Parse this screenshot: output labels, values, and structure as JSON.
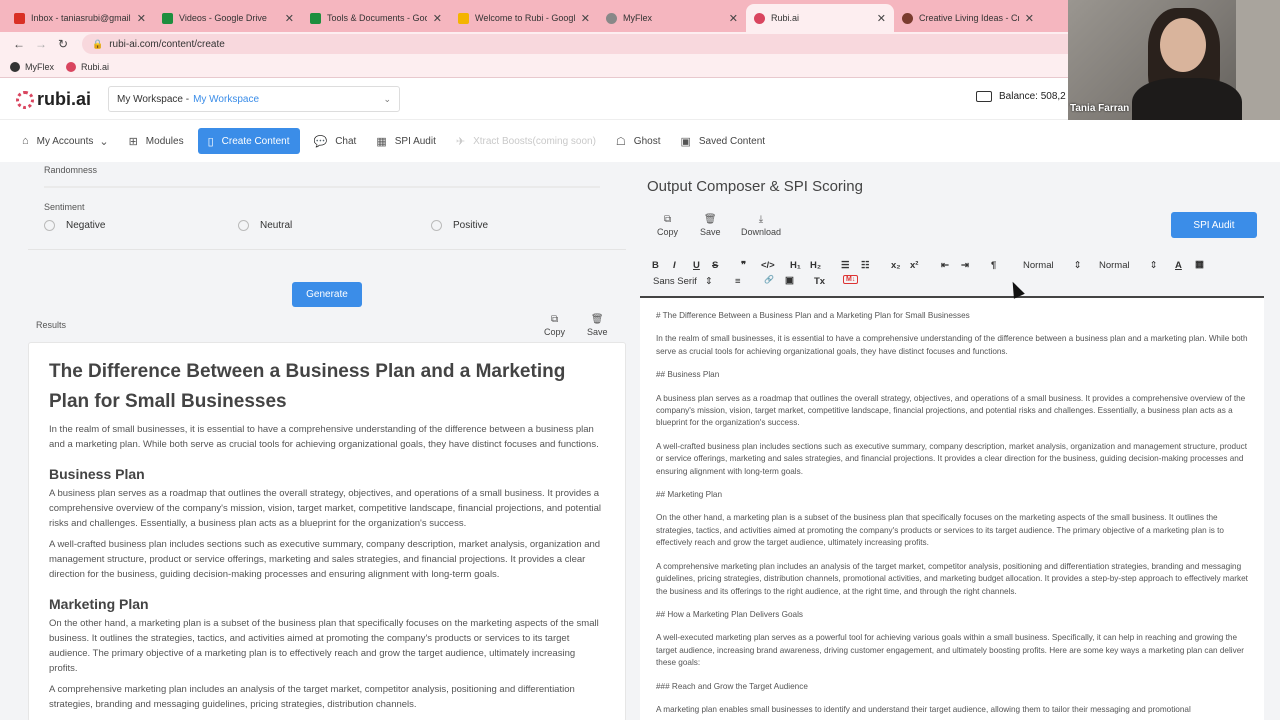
{
  "browser": {
    "tabs": [
      {
        "title": "Inbox - taniasrubi@gmail.c",
        "color": "#d93025"
      },
      {
        "title": "Videos - Google Drive",
        "color": "#1e8e3e"
      },
      {
        "title": "Tools & Documents - Goog",
        "color": "#1e8e3e"
      },
      {
        "title": "Welcome to Rubi - Google",
        "color": "#f4b400"
      },
      {
        "title": "MyFlex",
        "color": "#888888"
      },
      {
        "title": "Rubi.ai",
        "color": "#d9455f"
      },
      {
        "title": "Creative Living Ideas - Cre",
        "color": "#7a3b2e"
      }
    ],
    "url": "rubi-ai.com/content/create",
    "bookmarks": [
      {
        "label": "MyFlex",
        "color": "#333333"
      },
      {
        "label": "Rubi.ai",
        "color": "#d9455f"
      }
    ]
  },
  "header": {
    "logo_text": "rubi.ai",
    "workspace_label": "My Workspace -",
    "workspace_value": "My Workspace",
    "balance": "Balance: 508,2"
  },
  "nav": {
    "my_accounts": "My Accounts",
    "modules": "Modules",
    "create_content": "Create Content",
    "chat": "Chat",
    "spi_audit": "SPI Audit",
    "xtract": "Xtract Boosts(coming soon)",
    "ghost": "Ghost",
    "saved": "Saved Content"
  },
  "left": {
    "randomness_label": "Randomness",
    "sentiment_label": "Sentiment",
    "sentiment_options": [
      "Negative",
      "Neutral",
      "Positive"
    ],
    "generate": "Generate",
    "results_label": "Results",
    "copy": "Copy",
    "save": "Save",
    "article": {
      "title": "The Difference Between a Business Plan and a Marketing Plan for Small Businesses",
      "intro": "In the realm of small businesses, it is essential to have a comprehensive understanding of the difference between a business plan and a marketing plan. While both serve as crucial tools for achieving organizational goals, they have distinct focuses and functions.",
      "h_business": "Business Plan",
      "p_business1": "A business plan serves as a roadmap that outlines the overall strategy, objectives, and operations of a small business. It provides a comprehensive overview of the company's mission, vision, target market, competitive landscape, financial projections, and potential risks and challenges. Essentially, a business plan acts as a blueprint for the organization's success.",
      "p_business2": "A well-crafted business plan includes sections such as executive summary, company description, market analysis, organization and management structure, product or service offerings, marketing and sales strategies, and financial projections. It provides a clear direction for the business, guiding decision-making processes and ensuring alignment with long-term goals.",
      "h_marketing": "Marketing Plan",
      "p_marketing1": "On the other hand, a marketing plan is a subset of the business plan that specifically focuses on the marketing aspects of the small business. It outlines the strategies, tactics, and activities aimed at promoting the company's products or services to its target audience. The primary objective of a marketing plan is to effectively reach and grow the target audience, ultimately increasing profits.",
      "p_marketing2": "A comprehensive marketing plan includes an analysis of the target market, competitor analysis, positioning and differentiation strategies, branding and messaging guidelines, pricing strategies, distribution channels."
    }
  },
  "right": {
    "title": "Output Composer & SPI Scoring",
    "copy": "Copy",
    "save": "Save",
    "download": "Download",
    "spi_audit": "SPI Audit",
    "toolbar": {
      "bold": "B",
      "italic": "I",
      "underline": "U",
      "strike": "S",
      "quote": "❞",
      "code": "</>",
      "h1": "H₁",
      "h2": "H₂",
      "ol": "☰",
      "ul": "☷",
      "sub": "x₂",
      "sup": "x²",
      "outdent": "⇤",
      "indent": "⇥",
      "rtl": "¶",
      "size1": "Normal",
      "size2": "Normal",
      "color": "A",
      "bg": "▦",
      "font": "Sans Serif",
      "align": "≡",
      "link": "🔗",
      "image": "▣",
      "clear": "Tx",
      "md": "M↓"
    },
    "editor_lines": [
      "# The Difference Between a Business Plan and a Marketing Plan for Small Businesses",
      "In the realm of small businesses, it is essential to have a comprehensive understanding of the difference between a business plan and a marketing plan. While both serve as crucial tools for achieving organizational goals, they have distinct focuses and functions.",
      "## Business Plan",
      "A business plan serves as a roadmap that outlines the overall strategy, objectives, and operations of a small business. It provides a comprehensive overview of the company's mission, vision, target market, competitive landscape, financial projections, and potential risks and challenges. Essentially, a business plan acts as a blueprint for the organization's success.",
      "A well-crafted business plan includes sections such as executive summary, company description, market analysis, organization and management structure, product or service offerings, marketing and sales strategies, and financial projections. It provides a clear direction for the business, guiding decision-making processes and ensuring alignment with long-term goals.",
      "## Marketing Plan",
      "On the other hand, a marketing plan is a subset of the business plan that specifically focuses on the marketing aspects of the small business. It outlines the strategies, tactics, and activities aimed at promoting the company's products or services to its target audience. The primary objective of a marketing plan is to effectively reach and grow the target audience, ultimately increasing profits.",
      "A comprehensive marketing plan includes an analysis of the target market, competitor analysis, positioning and differentiation strategies, branding and messaging guidelines, pricing strategies, distribution channels, promotional activities, and marketing budget allocation. It provides a step-by-step approach to effectively market the business and its offerings to the right audience, at the right time, and through the right channels.",
      "## How a Marketing Plan Delivers Goals",
      "A well-executed marketing plan serves as a powerful tool for achieving various goals within a small business. Specifically, it can help in reaching and growing the target audience, increasing brand awareness, driving customer engagement, and ultimately boosting profits. Here are some key ways a marketing plan can deliver these goals:",
      "### Reach and Grow the Target Audience",
      "A marketing plan enables small businesses to identify and understand their target audience, allowing them to tailor their messaging and promotional"
    ]
  },
  "webcam": {
    "name": "Tania Farran"
  }
}
